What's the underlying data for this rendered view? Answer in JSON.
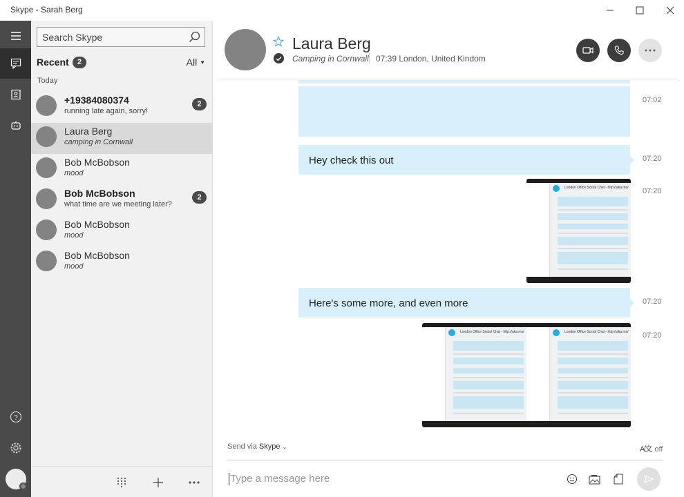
{
  "window": {
    "title": "Skype - Sarah Berg"
  },
  "search": {
    "placeholder": "Search Skype"
  },
  "recent": {
    "label": "Recent",
    "count": "2",
    "filter": "All",
    "group": "Today"
  },
  "contacts": [
    {
      "name": "+19384080374",
      "subtitle": "running late again, sorry!",
      "unread": "2",
      "bold": true,
      "italic": false
    },
    {
      "name": "Laura Berg",
      "subtitle": "camping in Cornwall",
      "unread": "",
      "bold": false,
      "italic": true,
      "selected": true
    },
    {
      "name": "Bob McBobson",
      "subtitle": "mood",
      "unread": "",
      "bold": false,
      "italic": true
    },
    {
      "name": "Bob McBobson",
      "subtitle": "what time are we meeting later?",
      "unread": "2",
      "bold": true,
      "italic": false
    },
    {
      "name": "Bob McBobson",
      "subtitle": "mood",
      "unread": "",
      "bold": false,
      "italic": true
    },
    {
      "name": "Bob McBobson",
      "subtitle": "mood",
      "unread": "",
      "bold": false,
      "italic": true
    }
  ],
  "chat": {
    "name": "Laura Berg",
    "mood": "Camping in Cornwall",
    "location": "07:39 London, United Kindom"
  },
  "messages": [
    {
      "type": "blank",
      "time": "07:02"
    },
    {
      "type": "text",
      "text": "Hey check this out",
      "time": "07:20"
    },
    {
      "type": "image",
      "time": "07:20",
      "image_title": "London Office Social Chat - http://aka.ms/"
    },
    {
      "type": "text",
      "text": "Here's some more, and even more",
      "time": "07:20"
    },
    {
      "type": "image",
      "time": "07:20",
      "image_title": "London Office Social Chat - http://aka.ms/",
      "image_title_2": "London Office Social Chat - http://aka.ms/"
    }
  ],
  "composer": {
    "send_via_label": "Send via",
    "send_via_value": "Skype",
    "translate": "off",
    "placeholder": "Type a message here"
  },
  "colors": {
    "bubble": "#d7f0fa",
    "rail": "#4a4a4a",
    "accent": "#27a9e1"
  },
  "icons": [
    "menu-icon",
    "chat-icon",
    "contacts-icon",
    "bots-icon",
    "help-icon",
    "settings-icon",
    "search-icon",
    "star-icon",
    "video-call-icon",
    "audio-call-icon",
    "more-icon",
    "dialpad-icon",
    "add-icon",
    "emoji-icon",
    "image-icon",
    "file-icon",
    "send-icon"
  ]
}
